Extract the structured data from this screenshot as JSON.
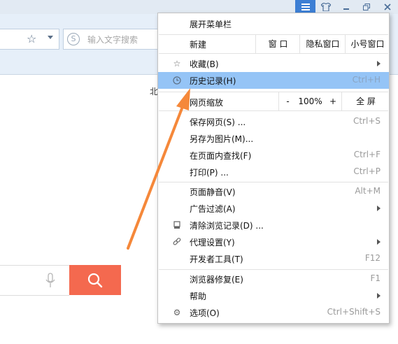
{
  "search": {
    "placeholder": "输入文字搜索"
  },
  "page": {
    "fragment": "北"
  },
  "menu": {
    "header": "展开菜单栏",
    "new_window": {
      "label": "新建",
      "window": "窗 口",
      "private": "隐私窗口",
      "small": "小号窗口"
    },
    "favorites": "收藏(B)",
    "history": {
      "label": "历史记录(H)",
      "shortcut": "Ctrl+H"
    },
    "zoom": {
      "label": "网页缩放",
      "minus": "-",
      "value": "100%",
      "plus": "+",
      "fullscreen": "全 屏"
    },
    "save_page": {
      "label": "保存网页(S) ...",
      "shortcut": "Ctrl+S"
    },
    "save_image": {
      "label": "另存为图片(M)..."
    },
    "find": {
      "label": "在页面内查找(F)",
      "shortcut": "Ctrl+F"
    },
    "print": {
      "label": "打印(P) ...",
      "shortcut": "Ctrl+P"
    },
    "mute": {
      "label": "页面静音(V)",
      "shortcut": "Alt+M"
    },
    "adblock": "广告过滤(A)",
    "clear": "清除浏览记录(D) ...",
    "proxy": "代理设置(Y)",
    "devtools": {
      "label": "开发者工具(T)",
      "shortcut": "F12"
    },
    "repair": {
      "label": "浏览器修复(E)",
      "shortcut": "F1"
    },
    "help": "帮助",
    "options": {
      "label": "选项(O)",
      "shortcut": "Ctrl+Shift+S"
    }
  },
  "colors": {
    "highlight": "#95c4f6",
    "search_button": "#f4694f",
    "arrow": "#f5883a"
  }
}
